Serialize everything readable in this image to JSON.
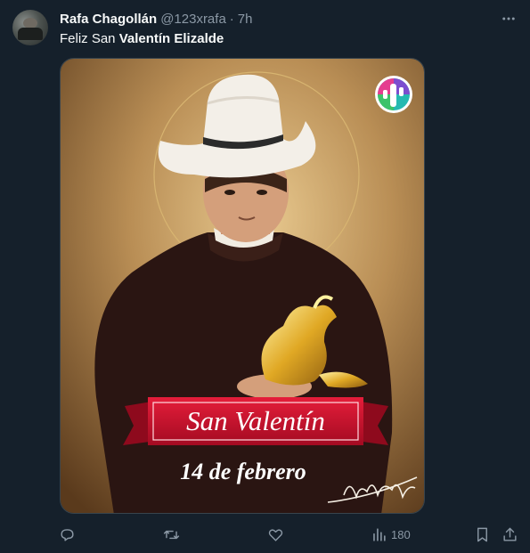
{
  "tweet": {
    "author_name": "Rafa Chagollán",
    "author_handle": "@123xrafa",
    "separator": "·",
    "time": "7h",
    "text_plain": "Feliz San ",
    "text_bold": "Valentín Elizalde"
  },
  "media": {
    "banner_text": "San Valentín",
    "date_text": "14 de febrero",
    "signature_text": "Valentín Elizalde",
    "logo_icon": "cactus-logo-icon"
  },
  "actions": {
    "reply_icon": "reply-icon",
    "retweet_icon": "retweet-icon",
    "like_icon": "heart-icon",
    "views_icon": "views-icon",
    "views_count": "180",
    "bookmark_icon": "bookmark-icon",
    "share_icon": "share-icon"
  },
  "colors": {
    "background": "#15202b",
    "muted": "#8b98a5",
    "banner_red": "#c8102e"
  }
}
